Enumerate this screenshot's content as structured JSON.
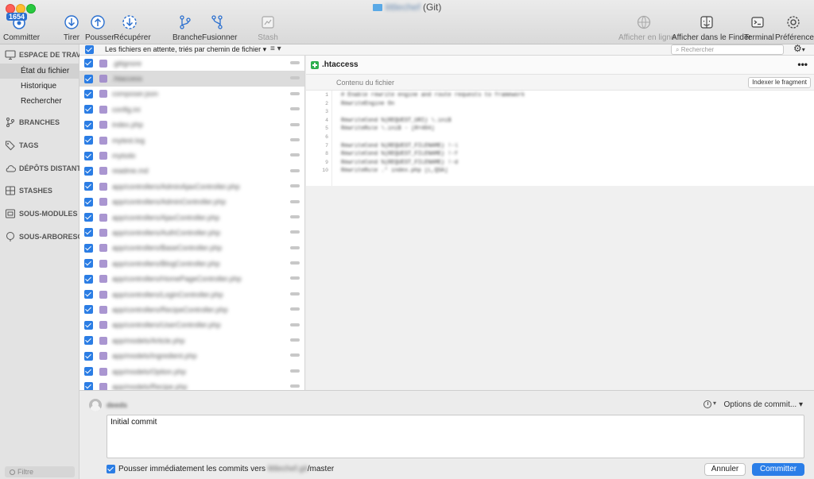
{
  "window": {
    "title_blurred": "littlechef",
    "title_suffix": "(Git)"
  },
  "toolbar": {
    "left": [
      {
        "label": "Committer",
        "icon": "commit-icon",
        "badge": "1654"
      },
      {
        "label": "Tirer",
        "icon": "pull-icon"
      },
      {
        "label": "Pousser",
        "icon": "push-icon"
      },
      {
        "label": "Récupérer",
        "icon": "fetch-icon"
      },
      {
        "label": "Branche",
        "icon": "branch-icon"
      },
      {
        "label": "Fusionner",
        "icon": "merge-icon"
      },
      {
        "label": "Stash",
        "icon": "stash-icon",
        "disabled": true
      }
    ],
    "right": [
      {
        "label": "Afficher en ligne",
        "icon": "globe-icon",
        "disabled": true
      },
      {
        "label": "Afficher dans le Finder",
        "icon": "finder-icon"
      },
      {
        "label": "Terminal",
        "icon": "terminal-icon"
      },
      {
        "label": "Préférences",
        "icon": "gear-icon"
      }
    ]
  },
  "sidebar": {
    "workspace": "ESPACE DE TRAV",
    "items": [
      "État du fichier",
      "Historique",
      "Rechercher"
    ],
    "sections": [
      "BRANCHES",
      "TAGS",
      "DÉPÔTS DISTANT",
      "STASHES",
      "SOUS-MODULES",
      "SOUS-ARBORESC"
    ],
    "filter_placeholder": "Filtre"
  },
  "list_header": {
    "sort_label": "Les fichiers en attente, triés par chemin de fichier",
    "search_placeholder": "Rechercher"
  },
  "files": [
    ".gitignore",
    ".htaccess",
    "composer.json",
    "config.ini",
    "index.php",
    "mytest.log",
    "mytodo",
    "readme.md",
    "app/controllers/AdminAjaxController.php",
    "app/controllers/AdminController.php",
    "app/controllers/AjaxController.php",
    "app/controllers/AuthController.php",
    "app/controllers/BaseController.php",
    "app/controllers/BlogController.php",
    "app/controllers/HomePageController.php",
    "app/controllers/LoginController.php",
    "app/controllers/RecipeController.php",
    "app/controllers/UserController.php",
    "app/models/Article.php",
    "app/models/Ingredient.php",
    "app/models/Option.php",
    "app/models/Recipe.php"
  ],
  "diff": {
    "filename": ".htaccess",
    "more_label": "•••",
    "hunk_label": "Contenu du fichier",
    "stage_button": "Indexer le fragment",
    "lines": [
      {
        "n": "1",
        "text": "# Enable rewrite engine and route requests to framework"
      },
      {
        "n": "2",
        "text": "RewriteEngine On"
      },
      {
        "n": "3",
        "text": ""
      },
      {
        "n": "4",
        "text": "RewriteCond %{REQUEST_URI} \\.ini$"
      },
      {
        "n": "5",
        "text": "RewriteRule \\.ini$ - [R=404]"
      },
      {
        "n": "6",
        "text": ""
      },
      {
        "n": "7",
        "text": "RewriteCond %{REQUEST_FILENAME} !-l"
      },
      {
        "n": "8",
        "text": "RewriteCond %{REQUEST_FILENAME} !-f"
      },
      {
        "n": "9",
        "text": "RewriteCond %{REQUEST_FILENAME} !-d"
      },
      {
        "n": "10",
        "text": "RewriteRule .* index.php [L,QSA]"
      }
    ]
  },
  "commit": {
    "author": "deeds",
    "options_label": "Options de commit...",
    "message": "Initial commit",
    "push_label_prefix": "Pousser immédiatement les commits vers ",
    "push_remote_blurred": "littlechef.git",
    "push_label_suffix": "/master",
    "cancel_label": "Annuler",
    "commit_label": "Committer"
  }
}
